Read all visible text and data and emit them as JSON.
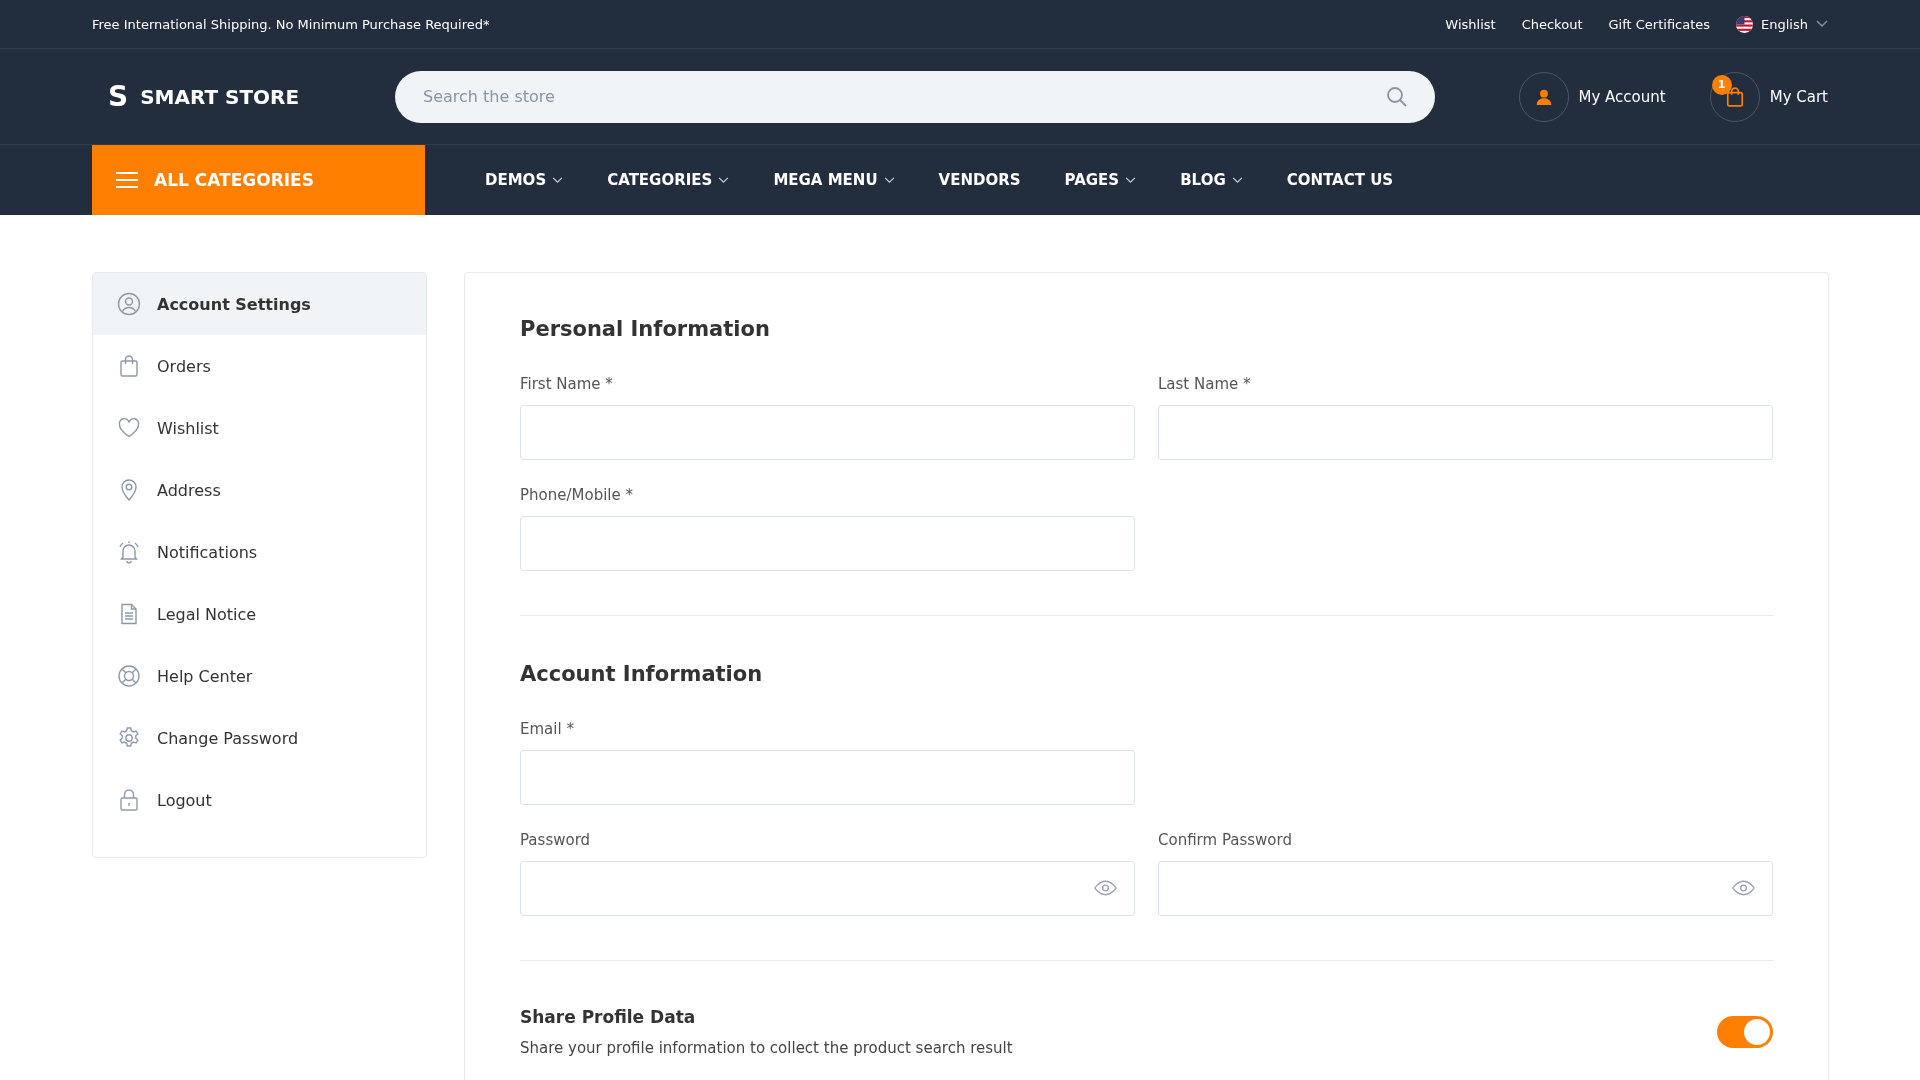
{
  "top_bar": {
    "announcement": "Free International Shipping. No Minimum Purchase Required*",
    "links": [
      "Wishlist",
      "Checkout",
      "Gift Certificates"
    ],
    "language": "English"
  },
  "header": {
    "logo_mark": "S",
    "logo_text": "SMART STORE",
    "search": {
      "placeholder": "Search the store"
    },
    "account": "My Account",
    "cart": {
      "label": "My Cart",
      "count": "1"
    }
  },
  "nav": {
    "all_categories": "ALL CATEGORIES",
    "items": [
      {
        "label": "DEMOS",
        "dropdown": true
      },
      {
        "label": "CATEGORIES",
        "dropdown": true
      },
      {
        "label": "MEGA MENU",
        "dropdown": true
      },
      {
        "label": "VENDORS",
        "dropdown": false
      },
      {
        "label": "PAGES",
        "dropdown": true
      },
      {
        "label": "BLOG",
        "dropdown": true
      },
      {
        "label": "CONTACT US",
        "dropdown": false
      }
    ]
  },
  "sidebar": {
    "items": [
      {
        "label": "Account Settings",
        "kind": "user",
        "selected": true
      },
      {
        "label": "Orders",
        "kind": "bag",
        "selected": false
      },
      {
        "label": "Wishlist",
        "kind": "heart",
        "selected": false
      },
      {
        "label": "Address",
        "kind": "pin",
        "selected": false
      },
      {
        "label": "Notifications",
        "kind": "bell",
        "selected": false
      },
      {
        "label": "Legal Notice",
        "kind": "document",
        "selected": false
      },
      {
        "label": "Help Center",
        "kind": "lifebuoy",
        "selected": false
      },
      {
        "label": "Change Password",
        "kind": "gear",
        "selected": false
      },
      {
        "label": "Logout",
        "kind": "lock",
        "selected": false
      }
    ]
  },
  "sections": [
    {
      "title": "Personal Information",
      "rows": [
        [
          {
            "label": "First Name *",
            "reveal": false
          },
          {
            "label": "Last Name *",
            "reveal": false
          }
        ],
        [
          {
            "label": "Phone/Mobile *",
            "reveal": false
          }
        ]
      ]
    },
    {
      "title": "Account Information",
      "rows": [
        [
          {
            "label": "Email *",
            "reveal": false
          }
        ],
        [
          {
            "label": "Password",
            "reveal": true
          },
          {
            "label": "Confirm Password",
            "reveal": true
          }
        ]
      ]
    }
  ],
  "share": {
    "title": "Share Profile Data",
    "description": "Share your profile information to collect the product search result",
    "on": true
  }
}
